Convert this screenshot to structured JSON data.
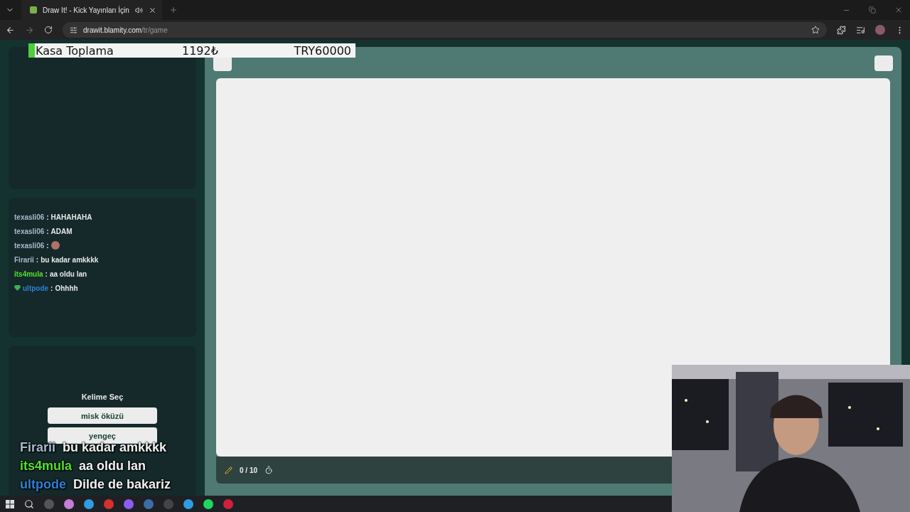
{
  "browser": {
    "tab_title": "Draw It! - Kick Yayınları İçin",
    "url_host": "drawit.blamity.com",
    "url_path": "/tr/game"
  },
  "goal_banner": {
    "label": "Kasa Toplama",
    "current": "1192₺",
    "target": "TRY60000",
    "level": 0.02
  },
  "chat": {
    "separator": ":",
    "messages": [
      {
        "user": "texasli06",
        "text": "HAHAHAHA",
        "color": "#a9b8cc",
        "badge": false,
        "kind": "text"
      },
      {
        "user": "texasli06",
        "text": "ADAM",
        "color": "#a9b8cc",
        "badge": false,
        "kind": "text"
      },
      {
        "user": "texasli06",
        "color": "#a9b8cc",
        "badge": false,
        "kind": "emoji"
      },
      {
        "user": "Firarii",
        "text": "bu kadar amkkkk",
        "color": "#a9b8cc",
        "badge": false,
        "kind": "text"
      },
      {
        "user": "its4mula",
        "text": "aa oldu lan",
        "color": "#53e02a",
        "badge": false,
        "kind": "text"
      },
      {
        "user": "ultpode",
        "text": "Ohhhh",
        "color": "#2f7fd6",
        "badge": true,
        "kind": "text"
      }
    ]
  },
  "word_picker": {
    "title": "Kelime Seç",
    "options": [
      "misk öküzü",
      "yengeç"
    ]
  },
  "canvas_bar": {
    "count": "0 / 10"
  },
  "overlay_chat": [
    {
      "user": "Firarii",
      "text": "bu kadar amkkkk",
      "color": "#a9b8cc"
    },
    {
      "user": "its4mula",
      "text": "aa oldu lan",
      "color": "#53e02a"
    },
    {
      "user": "ultpode",
      "text": "Dilde de bakariz",
      "color": "#2f7fd6"
    }
  ]
}
